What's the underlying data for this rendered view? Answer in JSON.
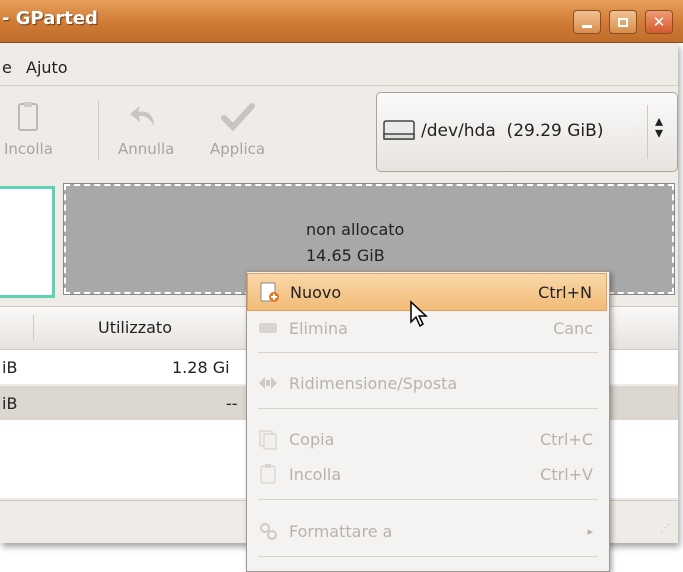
{
  "window": {
    "title": "- GParted"
  },
  "menubar": {
    "items": [
      "e",
      "Ajuto"
    ]
  },
  "toolbar": {
    "paste_label": "Incolla",
    "undo_label": "Annulla",
    "apply_label": "Applica",
    "device": "/dev/hda  (29.29 GiB)"
  },
  "partition_graphic": {
    "unallocated_label": "non allocato",
    "unallocated_size": "14.65 GiB"
  },
  "table": {
    "headers": [
      "Utilizzato"
    ],
    "rows": [
      {
        "size_fragment": "iB",
        "used": "1.28 Gi"
      },
      {
        "size_fragment": "iB",
        "used": "--"
      }
    ]
  },
  "context_menu": {
    "items": [
      {
        "label": "Nuovo",
        "accel": "Ctrl+N",
        "enabled": true,
        "highlighted": true,
        "icon": "new-partition-icon"
      },
      {
        "label": "Elimina",
        "accel": "Canc",
        "enabled": false,
        "icon": "delete-partition-icon"
      },
      {
        "label": "Ridimensione/Sposta",
        "accel": "",
        "enabled": false,
        "icon": "resize-move-icon"
      },
      {
        "label": "Copia",
        "accel": "Ctrl+C",
        "enabled": false,
        "icon": "copy-icon"
      },
      {
        "label": "Incolla",
        "accel": "Ctrl+V",
        "enabled": false,
        "icon": "paste-icon"
      },
      {
        "label": "Formattare a",
        "accel": "▸",
        "enabled": false,
        "icon": "format-icon"
      }
    ]
  },
  "colors": {
    "titlebar": "#cf7a35",
    "used_partition_border": "#5fd2b1",
    "unallocated_fill": "#a8a8a8",
    "menu_highlight": "#f2bb78"
  }
}
